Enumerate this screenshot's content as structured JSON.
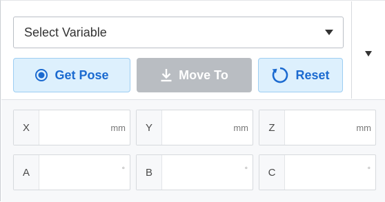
{
  "selector": {
    "value": "Select Variable"
  },
  "buttons": {
    "get_pose": "Get Pose",
    "move_to": "Move To",
    "reset": "Reset"
  },
  "fields": {
    "x": {
      "label": "X",
      "unit": "mm",
      "value": ""
    },
    "y": {
      "label": "Y",
      "unit": "mm",
      "value": ""
    },
    "z": {
      "label": "Z",
      "unit": "mm",
      "value": ""
    },
    "a": {
      "label": "A",
      "unit": "°",
      "value": ""
    },
    "b": {
      "label": "B",
      "unit": "°",
      "value": ""
    },
    "c": {
      "label": "C",
      "unit": "°",
      "value": ""
    }
  },
  "colors": {
    "accent": "#1b6ad0",
    "accent_bg": "#ddf0fd",
    "disabled_bg": "#b9bdc2"
  },
  "icons": {
    "get_pose": "radio-target-icon",
    "move_to": "download-arrow-icon",
    "reset": "refresh-icon",
    "dropdown": "chevron-down-icon",
    "panel_menu": "caret-down-icon"
  }
}
